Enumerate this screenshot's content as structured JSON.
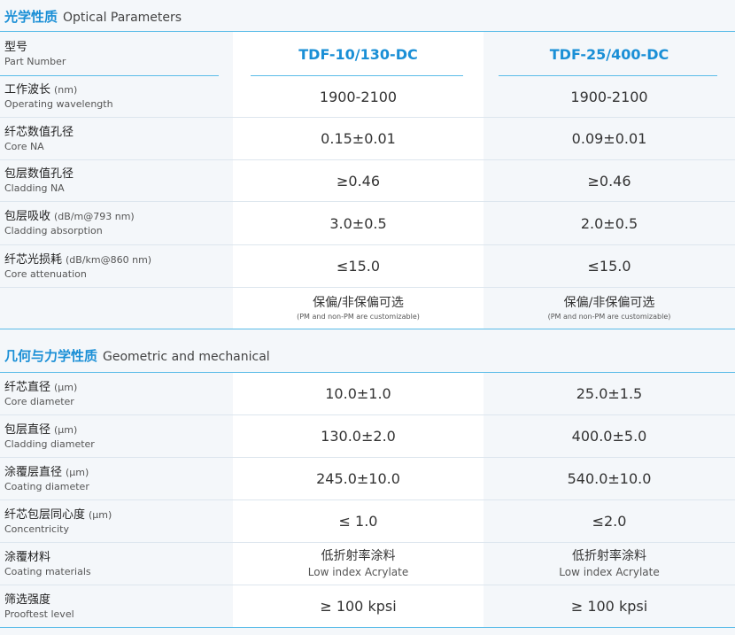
{
  "optical": {
    "title_zh": "光学性质",
    "title_en": "Optical Parameters",
    "header": {
      "label_zh": "型号",
      "label_en": "Part Number",
      "models": [
        "TDF-10/130-DC",
        "TDF-25/400-DC"
      ]
    },
    "rows": [
      {
        "zh": "工作波长",
        "unit": "(nm)",
        "en": "Operating wavelength",
        "v1": "1900-2100",
        "v2": "1900-2100"
      },
      {
        "zh": "纤芯数值孔径",
        "unit": "",
        "en": "Core NA",
        "v1": "0.15±0.01",
        "v2": "0.09±0.01"
      },
      {
        "zh": "包层数值孔径",
        "unit": "",
        "en": "Cladding NA",
        "v1": "≥0.46",
        "v2": "≥0.46"
      },
      {
        "zh": "包层吸收",
        "unit": "(dB/m@793 nm)",
        "en": "Cladding absorption",
        "v1": "3.0±0.5",
        "v2": "2.0±0.5"
      },
      {
        "zh": "纤芯光损耗",
        "unit": "(dB/km@860 nm)",
        "en": "Core attenuation",
        "v1": "≤15.0",
        "v2": "≤15.0"
      }
    ],
    "pm": {
      "zh": "保偏/非保偏可选",
      "en": "(PM and non-PM are customizable)"
    }
  },
  "geometric": {
    "title_zh": "几何与力学性质",
    "title_en": "Geometric and mechanical",
    "rows": [
      {
        "zh": "纤芯直径",
        "unit": "(μm)",
        "en": "Core diameter",
        "v1": "10.0±1.0",
        "v2": "25.0±1.5"
      },
      {
        "zh": "包层直径",
        "unit": "(μm)",
        "en": "Cladding diameter",
        "v1": "130.0±2.0",
        "v2": "400.0±5.0"
      },
      {
        "zh": "涂覆层直径",
        "unit": "(μm)",
        "en": "Coating diameter",
        "v1": "245.0±10.0",
        "v2": "540.0±10.0"
      },
      {
        "zh": "纤芯包层同心度",
        "unit": "(μm)",
        "en": "Concentricity",
        "v1": "≤ 1.0",
        "v2": "≤2.0"
      },
      {
        "zh": "涂覆材料",
        "unit": "",
        "en": "Coating materials",
        "v1_zh": "低折射率涂料",
        "v1_en": "Low index Acrylate",
        "v2_zh": "低折射率涂料",
        "v2_en": "Low index Acrylate"
      },
      {
        "zh": "筛选强度",
        "unit": "",
        "en": "Prooftest level",
        "v1": "≥ 100 kpsi",
        "v2": "≥ 100 kpsi"
      }
    ]
  }
}
